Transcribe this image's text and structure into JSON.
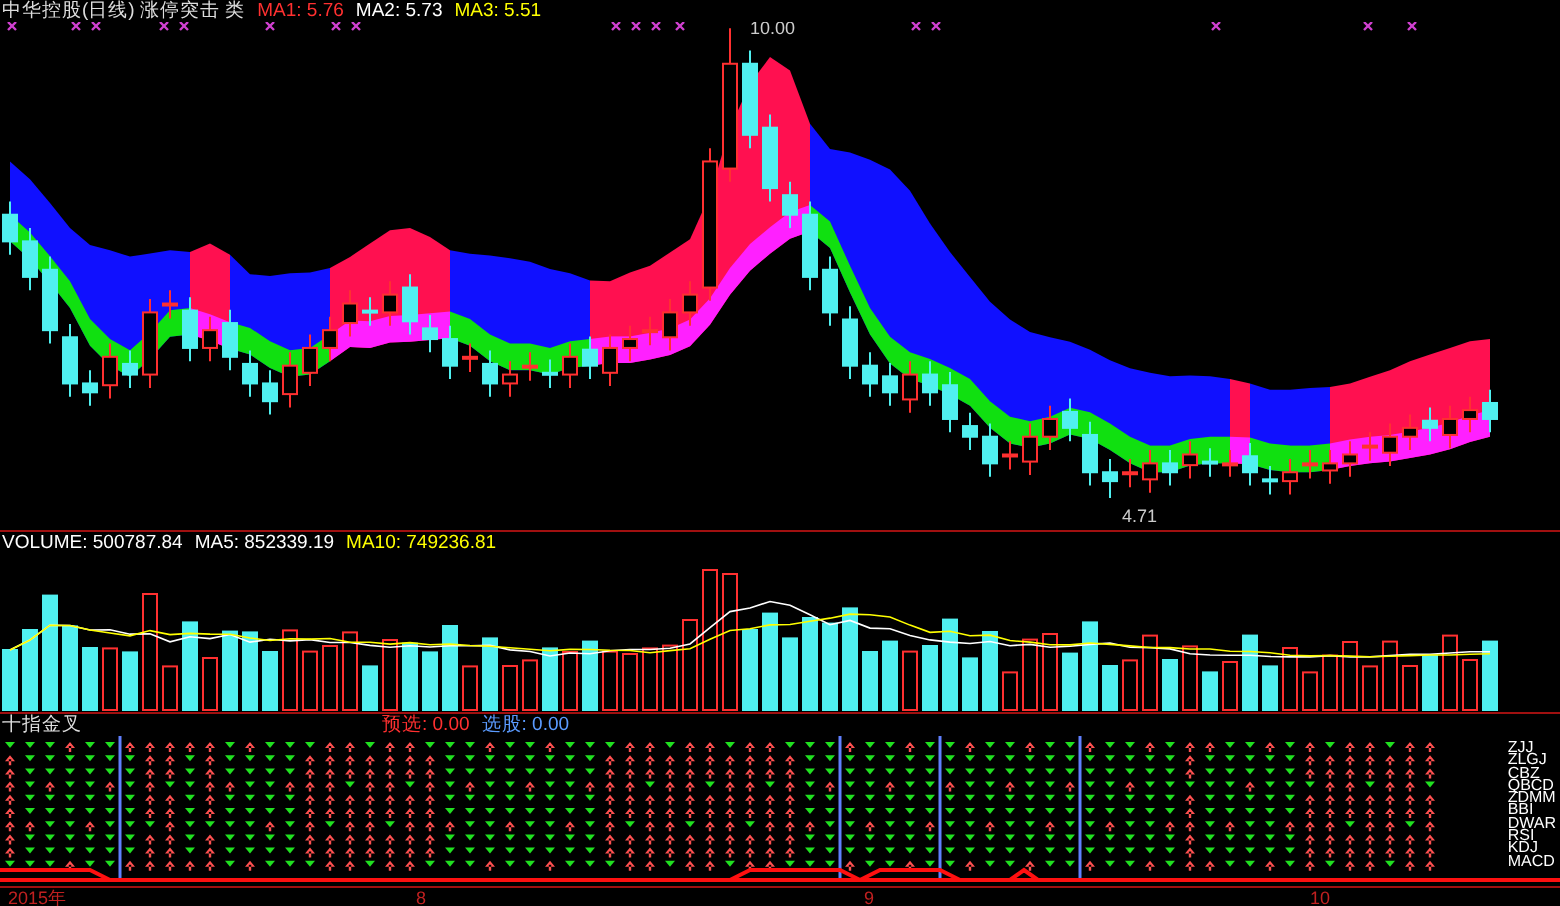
{
  "price_panel": {
    "title": "中华控股(日线) 涨停突击 类",
    "indicators": [
      {
        "text": "MA1: 5.76",
        "color": "#ff3030"
      },
      {
        "text": "MA2: 5.73",
        "color": "#ffffff"
      },
      {
        "text": "MA3: 5.51",
        "color": "#ffff00"
      }
    ],
    "high_label": "10.00",
    "low_label": "4.71"
  },
  "volume_panel": {
    "indicators": [
      {
        "text": "VOLUME: 500787.84",
        "color": "#ffffff"
      },
      {
        "text": "MA5: 852339.19",
        "color": "#ffffff"
      },
      {
        "text": "MA10: 749236.81",
        "color": "#ffff00"
      }
    ]
  },
  "signal_panel": {
    "title": "十指金叉",
    "readouts": [
      {
        "text": "预选: 0.00",
        "color": "#ff3030"
      },
      {
        "text": "选股: 0.00",
        "color": "#5b9bff"
      }
    ],
    "indicator_names": [
      "ZJJ",
      "ZLGJ",
      "CBZ",
      "QBCD",
      "ZDMM",
      "BBI",
      "DWAR",
      "RSI",
      "KDJ",
      "MACD"
    ]
  },
  "time_axis": [
    "2015年",
    "8",
    "9",
    "10"
  ]
}
